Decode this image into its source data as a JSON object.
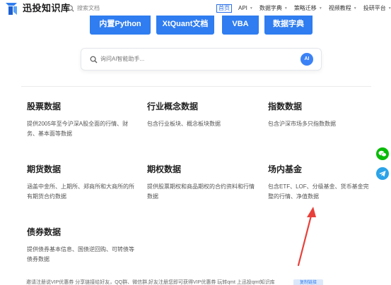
{
  "header": {
    "brand": "迅投知识库",
    "search_placeholder": "搜索文档",
    "nav": [
      {
        "label": "首页",
        "active": true,
        "dropdown": false
      },
      {
        "label": "API",
        "active": false,
        "dropdown": true
      },
      {
        "label": "数据字典",
        "active": false,
        "dropdown": true
      },
      {
        "label": "策略迁移",
        "active": false,
        "dropdown": true
      },
      {
        "label": "视频教程",
        "active": false,
        "dropdown": true
      },
      {
        "label": "投研平台",
        "active": false,
        "dropdown": true
      }
    ]
  },
  "doc_buttons": [
    "内置Python",
    "XtQuant文档",
    "VBA",
    "数据字典"
  ],
  "ai_search": {
    "placeholder": "询问AI智能助手...",
    "badge": "AI"
  },
  "categories": [
    {
      "title": "股票数据",
      "desc": "提供2005年至今沪深A股全面的行情、财务、基本面等数据"
    },
    {
      "title": "行业概念数据",
      "desc": "包含行业板块、概念板块数据"
    },
    {
      "title": "指数数据",
      "desc": "包含沪深市场多只指数数据"
    },
    {
      "title": "期货数据",
      "desc": "涵盖中金所、上期所、郑商所和大商所的所有期货合约数据"
    },
    {
      "title": "期权数据",
      "desc": "提供股票期权和商品期权的合约资料和行情数据"
    },
    {
      "title": "场内基金",
      "desc": "包含ETF、LOF、分级基金、货币基金完整的行情、净值数据"
    },
    {
      "title": "债券数据",
      "desc": "提供债券基本信息、国债逆回购、可转债等债券数据"
    }
  ],
  "promo": {
    "text": "邀请注册说VIP优惠券 分享链接给好友，QQ群、微信群,好友注册您即可获得VIP优惠券 玩转qmt 上迅投qmt知识库",
    "button": "复制链接"
  },
  "icons": {
    "logo": "xuntou-logo-icon",
    "search": "search-icon",
    "wechat": "wechat-icon",
    "telegram": "send-icon",
    "annotation_color": "#e8403a"
  }
}
